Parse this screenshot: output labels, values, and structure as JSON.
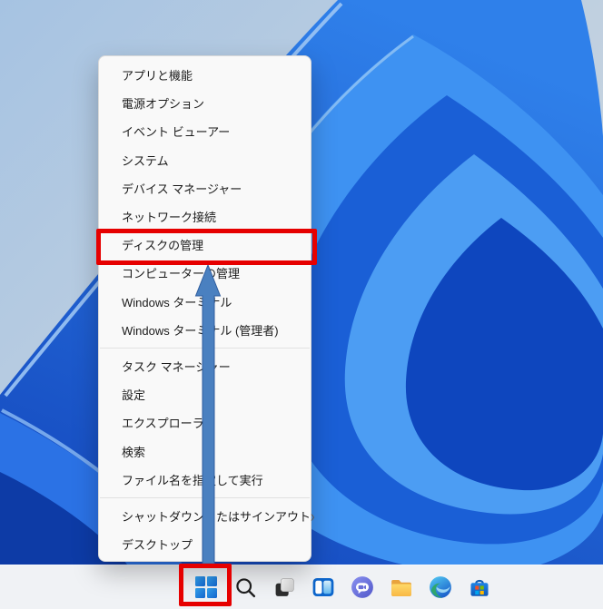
{
  "menu": {
    "submenu_glyph": "›",
    "items": [
      {
        "id": "apps-and-features",
        "label": "アプリと機能"
      },
      {
        "id": "power-options",
        "label": "電源オプション"
      },
      {
        "id": "event-viewer",
        "label": "イベント ビューアー"
      },
      {
        "id": "system",
        "label": "システム"
      },
      {
        "id": "device-manager",
        "label": "デバイス マネージャー"
      },
      {
        "id": "network-connections",
        "label": "ネットワーク接続"
      },
      {
        "id": "disk-management",
        "label": "ディスクの管理",
        "highlighted": true
      },
      {
        "id": "computer-management",
        "label": "コンピューターの管理"
      },
      {
        "id": "windows-terminal",
        "label": "Windows ターミナル"
      },
      {
        "id": "windows-terminal-admin",
        "label": "Windows ターミナル (管理者)"
      },
      {
        "separator": true
      },
      {
        "id": "task-manager",
        "label": "タスク マネージャー"
      },
      {
        "id": "settings",
        "label": "設定"
      },
      {
        "id": "file-explorer",
        "label": "エクスプローラー"
      },
      {
        "id": "search",
        "label": "検索"
      },
      {
        "id": "run",
        "label": "ファイル名を指定して実行"
      },
      {
        "separator": true
      },
      {
        "id": "shutdown-or-sign-out",
        "label": "シャットダウンまたはサインアウト",
        "submenu": true
      },
      {
        "id": "desktop",
        "label": "デスクトップ"
      }
    ]
  },
  "taskbar": {
    "icons": [
      {
        "id": "start",
        "icon": "windows-logo-icon"
      },
      {
        "id": "search",
        "icon": "search-icon"
      },
      {
        "id": "task-view",
        "icon": "task-view-icon"
      },
      {
        "id": "widgets",
        "icon": "widgets-icon"
      },
      {
        "id": "chat",
        "icon": "chat-icon"
      },
      {
        "id": "file-explorer",
        "icon": "folder-icon"
      },
      {
        "id": "edge",
        "icon": "edge-icon"
      },
      {
        "id": "store",
        "icon": "store-icon"
      }
    ]
  },
  "annotations": {
    "highlight_color": "#e60000",
    "arrow_fill": "#4a80c0",
    "arrow_stroke": "#2f5d9e",
    "arrow_from": "start-button",
    "arrow_to": "menu-item-disk-management",
    "highlighted_menu_label": "ディスクの管理"
  },
  "colors": {
    "menu_background": "#f9f9f9",
    "menu_text": "#1b1b1b",
    "taskbar_background": "#f0f2f5",
    "wallpaper_light": "#aac6e2",
    "wallpaper_blue_dark": "#1346bc",
    "wallpaper_blue_bright": "#3e92f2"
  }
}
